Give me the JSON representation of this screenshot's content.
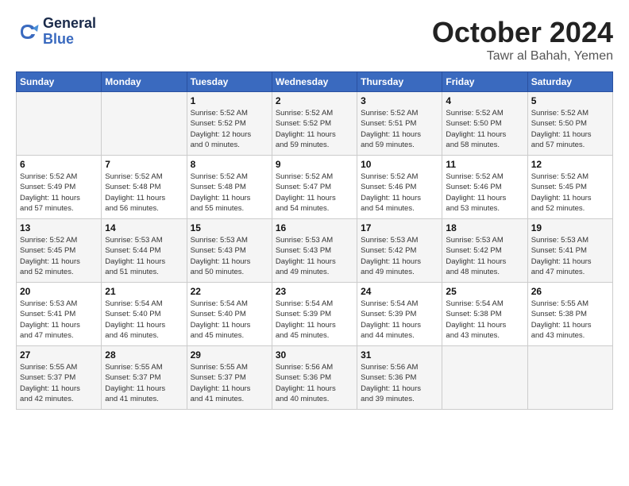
{
  "logo": {
    "text_general": "General",
    "text_blue": "Blue"
  },
  "title": "October 2024",
  "location": "Tawr al Bahah, Yemen",
  "days_of_week": [
    "Sunday",
    "Monday",
    "Tuesday",
    "Wednesday",
    "Thursday",
    "Friday",
    "Saturday"
  ],
  "weeks": [
    [
      {
        "day": "",
        "info": ""
      },
      {
        "day": "",
        "info": ""
      },
      {
        "day": "1",
        "info": "Sunrise: 5:52 AM\nSunset: 5:52 PM\nDaylight: 12 hours\nand 0 minutes."
      },
      {
        "day": "2",
        "info": "Sunrise: 5:52 AM\nSunset: 5:52 PM\nDaylight: 11 hours\nand 59 minutes."
      },
      {
        "day": "3",
        "info": "Sunrise: 5:52 AM\nSunset: 5:51 PM\nDaylight: 11 hours\nand 59 minutes."
      },
      {
        "day": "4",
        "info": "Sunrise: 5:52 AM\nSunset: 5:50 PM\nDaylight: 11 hours\nand 58 minutes."
      },
      {
        "day": "5",
        "info": "Sunrise: 5:52 AM\nSunset: 5:50 PM\nDaylight: 11 hours\nand 57 minutes."
      }
    ],
    [
      {
        "day": "6",
        "info": "Sunrise: 5:52 AM\nSunset: 5:49 PM\nDaylight: 11 hours\nand 57 minutes."
      },
      {
        "day": "7",
        "info": "Sunrise: 5:52 AM\nSunset: 5:48 PM\nDaylight: 11 hours\nand 56 minutes."
      },
      {
        "day": "8",
        "info": "Sunrise: 5:52 AM\nSunset: 5:48 PM\nDaylight: 11 hours\nand 55 minutes."
      },
      {
        "day": "9",
        "info": "Sunrise: 5:52 AM\nSunset: 5:47 PM\nDaylight: 11 hours\nand 54 minutes."
      },
      {
        "day": "10",
        "info": "Sunrise: 5:52 AM\nSunset: 5:46 PM\nDaylight: 11 hours\nand 54 minutes."
      },
      {
        "day": "11",
        "info": "Sunrise: 5:52 AM\nSunset: 5:46 PM\nDaylight: 11 hours\nand 53 minutes."
      },
      {
        "day": "12",
        "info": "Sunrise: 5:52 AM\nSunset: 5:45 PM\nDaylight: 11 hours\nand 52 minutes."
      }
    ],
    [
      {
        "day": "13",
        "info": "Sunrise: 5:52 AM\nSunset: 5:45 PM\nDaylight: 11 hours\nand 52 minutes."
      },
      {
        "day": "14",
        "info": "Sunrise: 5:53 AM\nSunset: 5:44 PM\nDaylight: 11 hours\nand 51 minutes."
      },
      {
        "day": "15",
        "info": "Sunrise: 5:53 AM\nSunset: 5:43 PM\nDaylight: 11 hours\nand 50 minutes."
      },
      {
        "day": "16",
        "info": "Sunrise: 5:53 AM\nSunset: 5:43 PM\nDaylight: 11 hours\nand 49 minutes."
      },
      {
        "day": "17",
        "info": "Sunrise: 5:53 AM\nSunset: 5:42 PM\nDaylight: 11 hours\nand 49 minutes."
      },
      {
        "day": "18",
        "info": "Sunrise: 5:53 AM\nSunset: 5:42 PM\nDaylight: 11 hours\nand 48 minutes."
      },
      {
        "day": "19",
        "info": "Sunrise: 5:53 AM\nSunset: 5:41 PM\nDaylight: 11 hours\nand 47 minutes."
      }
    ],
    [
      {
        "day": "20",
        "info": "Sunrise: 5:53 AM\nSunset: 5:41 PM\nDaylight: 11 hours\nand 47 minutes."
      },
      {
        "day": "21",
        "info": "Sunrise: 5:54 AM\nSunset: 5:40 PM\nDaylight: 11 hours\nand 46 minutes."
      },
      {
        "day": "22",
        "info": "Sunrise: 5:54 AM\nSunset: 5:40 PM\nDaylight: 11 hours\nand 45 minutes."
      },
      {
        "day": "23",
        "info": "Sunrise: 5:54 AM\nSunset: 5:39 PM\nDaylight: 11 hours\nand 45 minutes."
      },
      {
        "day": "24",
        "info": "Sunrise: 5:54 AM\nSunset: 5:39 PM\nDaylight: 11 hours\nand 44 minutes."
      },
      {
        "day": "25",
        "info": "Sunrise: 5:54 AM\nSunset: 5:38 PM\nDaylight: 11 hours\nand 43 minutes."
      },
      {
        "day": "26",
        "info": "Sunrise: 5:55 AM\nSunset: 5:38 PM\nDaylight: 11 hours\nand 43 minutes."
      }
    ],
    [
      {
        "day": "27",
        "info": "Sunrise: 5:55 AM\nSunset: 5:37 PM\nDaylight: 11 hours\nand 42 minutes."
      },
      {
        "day": "28",
        "info": "Sunrise: 5:55 AM\nSunset: 5:37 PM\nDaylight: 11 hours\nand 41 minutes."
      },
      {
        "day": "29",
        "info": "Sunrise: 5:55 AM\nSunset: 5:37 PM\nDaylight: 11 hours\nand 41 minutes."
      },
      {
        "day": "30",
        "info": "Sunrise: 5:56 AM\nSunset: 5:36 PM\nDaylight: 11 hours\nand 40 minutes."
      },
      {
        "day": "31",
        "info": "Sunrise: 5:56 AM\nSunset: 5:36 PM\nDaylight: 11 hours\nand 39 minutes."
      },
      {
        "day": "",
        "info": ""
      },
      {
        "day": "",
        "info": ""
      }
    ]
  ]
}
